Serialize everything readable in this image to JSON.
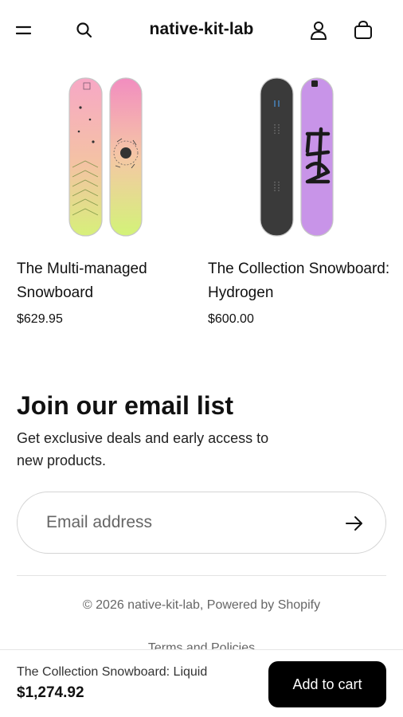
{
  "header": {
    "store_name": "native-kit-lab",
    "icons": [
      "menu-icon",
      "search-icon",
      "account-icon",
      "cart-icon"
    ]
  },
  "products": [
    {
      "title": "The Multi-managed Snowboard",
      "price": "$629.95"
    },
    {
      "title": "The Collection Snowboard: Hydrogen",
      "price": "$600.00"
    }
  ],
  "newsletter": {
    "title": "Join our email list",
    "description": "Get exclusive deals and early access to new products.",
    "email_placeholder": "Email address",
    "submit_icon": "arrow-right-icon"
  },
  "footer": {
    "copyright": "© 2026 native-kit-lab, Powered by Shopify",
    "policies_link": "Terms and Policies"
  },
  "sticky_cart": {
    "product_name": "The Collection Snowboard: Liquid",
    "price": "$1,274.92",
    "button_label": "Add to cart"
  },
  "colors": {
    "text": "#111111",
    "muted": "#666666",
    "button_bg": "#000000",
    "button_text": "#ffffff",
    "border": "#d4d4d4"
  }
}
